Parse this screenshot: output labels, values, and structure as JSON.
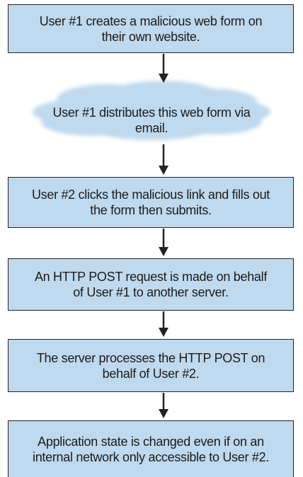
{
  "diagram": {
    "steps": [
      {
        "label": "User #1 creates a malicious web form on their own website."
      },
      {
        "label": "User #1 distributes this web form via email."
      },
      {
        "label": "User #2 clicks the malicious link and fills out the form then submits."
      },
      {
        "label": "An HTTP POST request is made on behalf of User #1 to another server."
      },
      {
        "label": "The server processes the HTTP POST on behalf of User #2."
      },
      {
        "label": "Application state is changed even if on an internal network only accessible to User #2."
      }
    ]
  },
  "colors": {
    "box_fill": "#bfd9ee",
    "cloud_fill": "#bfd9ee",
    "stroke": "#232323",
    "text": "#1c1c1c"
  }
}
